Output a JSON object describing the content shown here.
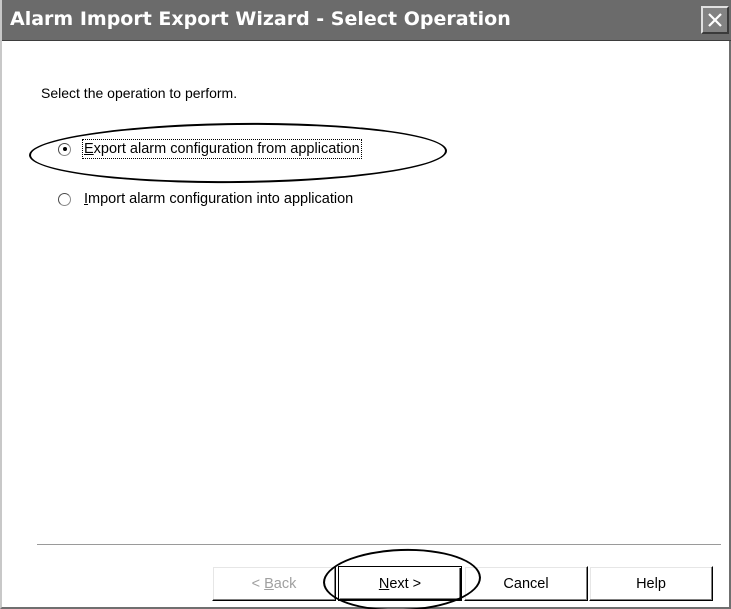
{
  "window": {
    "title": "Alarm Import Export Wizard - Select Operation",
    "close_icon": "close-x-icon"
  },
  "prompt": "Select the operation to perform.",
  "options": [
    {
      "label_mnemonic": "E",
      "label_rest": "xport alarm configuration from application",
      "selected": true
    },
    {
      "label_mnemonic": "I",
      "label_rest": "mport alarm configuration into application",
      "selected": false
    }
  ],
  "buttons": {
    "back": {
      "prefix": "< ",
      "mnemonic": "B",
      "rest": "ack",
      "enabled": false
    },
    "next": {
      "mnemonic": "N",
      "rest": "ext >",
      "enabled": true
    },
    "cancel": {
      "label": "Cancel"
    },
    "help": {
      "label": "Help"
    }
  },
  "colors": {
    "titlebar": "#6b6b6b",
    "title_text": "#ffffff",
    "background": "#ffffff",
    "disabled_text": "#a0a0a0"
  }
}
